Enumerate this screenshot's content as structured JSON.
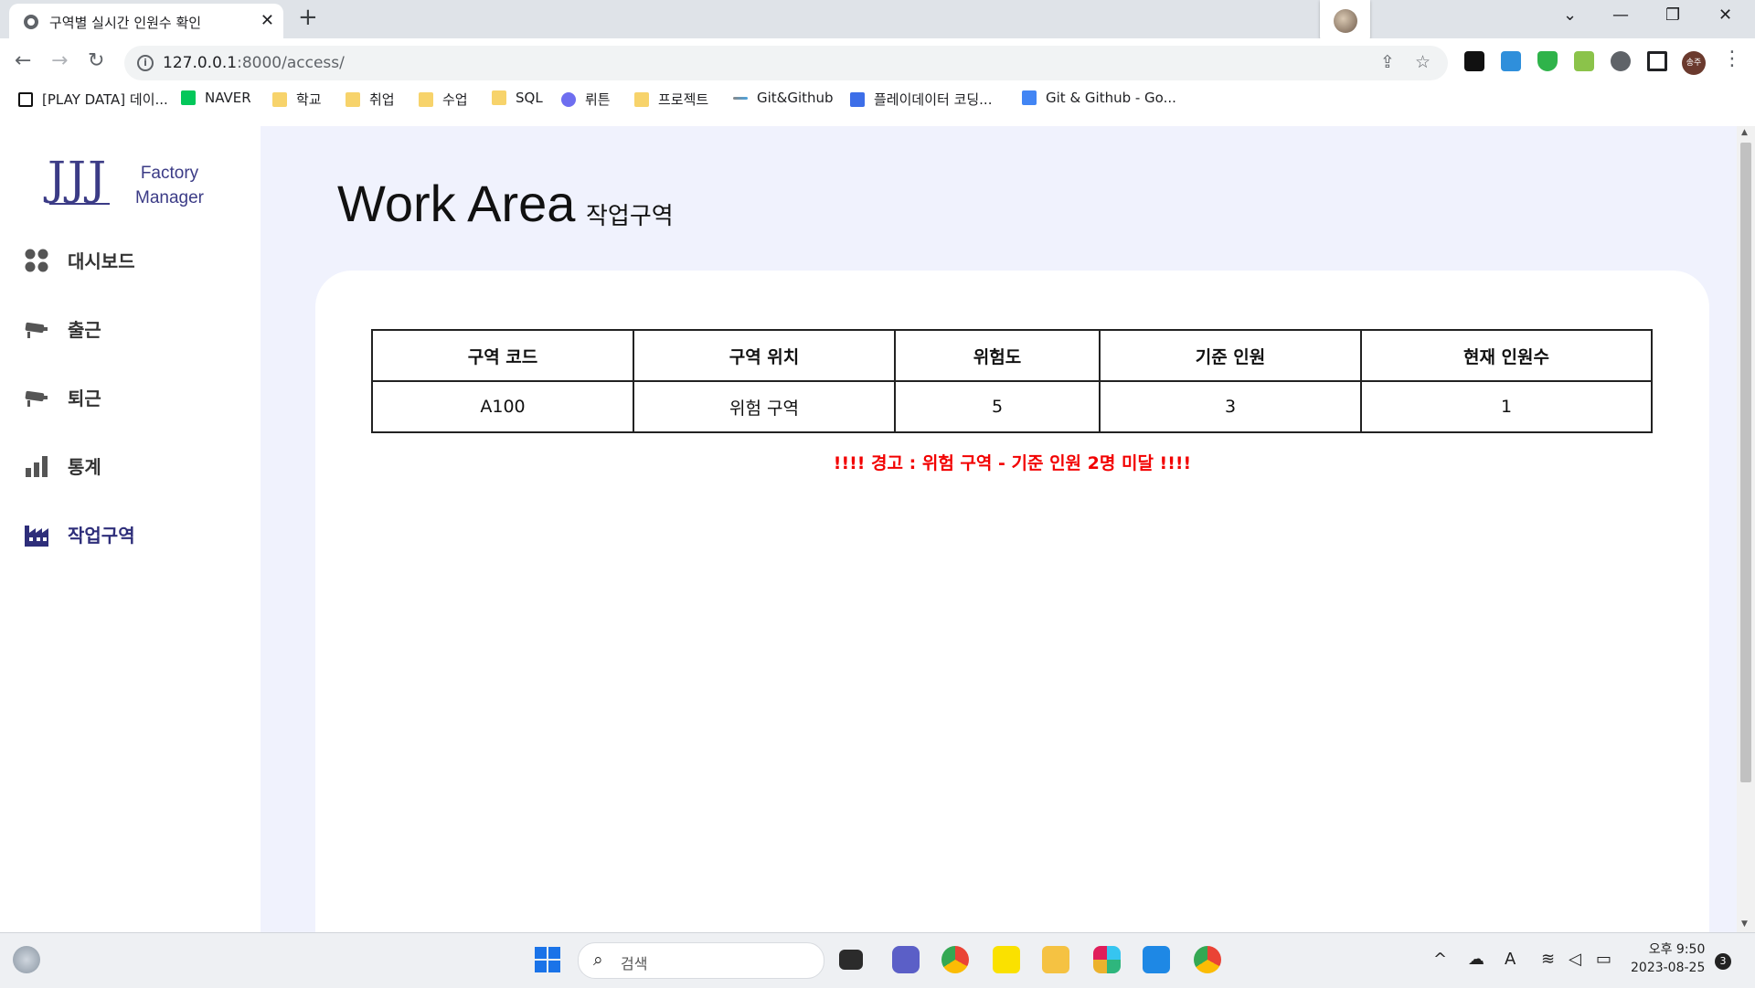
{
  "browser": {
    "tab_title": "구역별 실시간 인원수 확인",
    "tab_close": "✕",
    "new_tab": "+",
    "url_host": "127.0.0.1",
    "url_path": ":8000/access/",
    "window_controls": [
      "⌄",
      "—",
      "❐",
      "✕"
    ],
    "bookmarks": [
      {
        "label": "[PLAY DATA] 데이...",
        "icon": "notion-icon"
      },
      {
        "label": "NAVER",
        "icon": "naver-icon"
      },
      {
        "label": "학교",
        "icon": "folder-icon"
      },
      {
        "label": "취업",
        "icon": "folder-icon"
      },
      {
        "label": "수업",
        "icon": "folder-icon"
      },
      {
        "label": "SQL",
        "icon": "folder-icon"
      },
      {
        "label": "뤼튼",
        "icon": "wrtn-icon"
      },
      {
        "label": "프로젝트",
        "icon": "folder-icon"
      },
      {
        "label": "Git&Github",
        "icon": "git-icon"
      },
      {
        "label": "플레이데이터 코딩...",
        "icon": "playdata-icon"
      },
      {
        "label": "Git & Github - Go...",
        "icon": "docs-icon"
      }
    ],
    "profile_initials": "송주"
  },
  "sidebar": {
    "logo_mark": "JJJ",
    "logo_line1": "Factory",
    "logo_line2": "Manager",
    "items": [
      {
        "label": "대시보드",
        "icon": "dashboard-icon",
        "active": false
      },
      {
        "label": "출근",
        "icon": "camera-icon",
        "active": false
      },
      {
        "label": "퇴근",
        "icon": "camera-icon",
        "active": false
      },
      {
        "label": "통계",
        "icon": "bar-chart-icon",
        "active": false
      },
      {
        "label": "작업구역",
        "icon": "factory-icon",
        "active": true
      }
    ]
  },
  "main": {
    "title": "Work Area",
    "subtitle": "작업구역",
    "table": {
      "headers": [
        "구역 코드",
        "구역 위치",
        "위험도",
        "기준 인원",
        "현재 인원수"
      ],
      "rows": [
        [
          "A100",
          "위험 구역",
          "5",
          "3",
          "1"
        ]
      ]
    },
    "warning": "!!!! 경고 : 위험 구역 - 기준 인원 2명 미달 !!!!"
  },
  "taskbar": {
    "search_placeholder": "검색",
    "time": "오후 9:50",
    "date": "2023-08-25",
    "notifications": "3"
  },
  "colors": {
    "accent": "#2e2e7a",
    "main_bg": "#f0f2fd",
    "warning": "#f20000"
  }
}
